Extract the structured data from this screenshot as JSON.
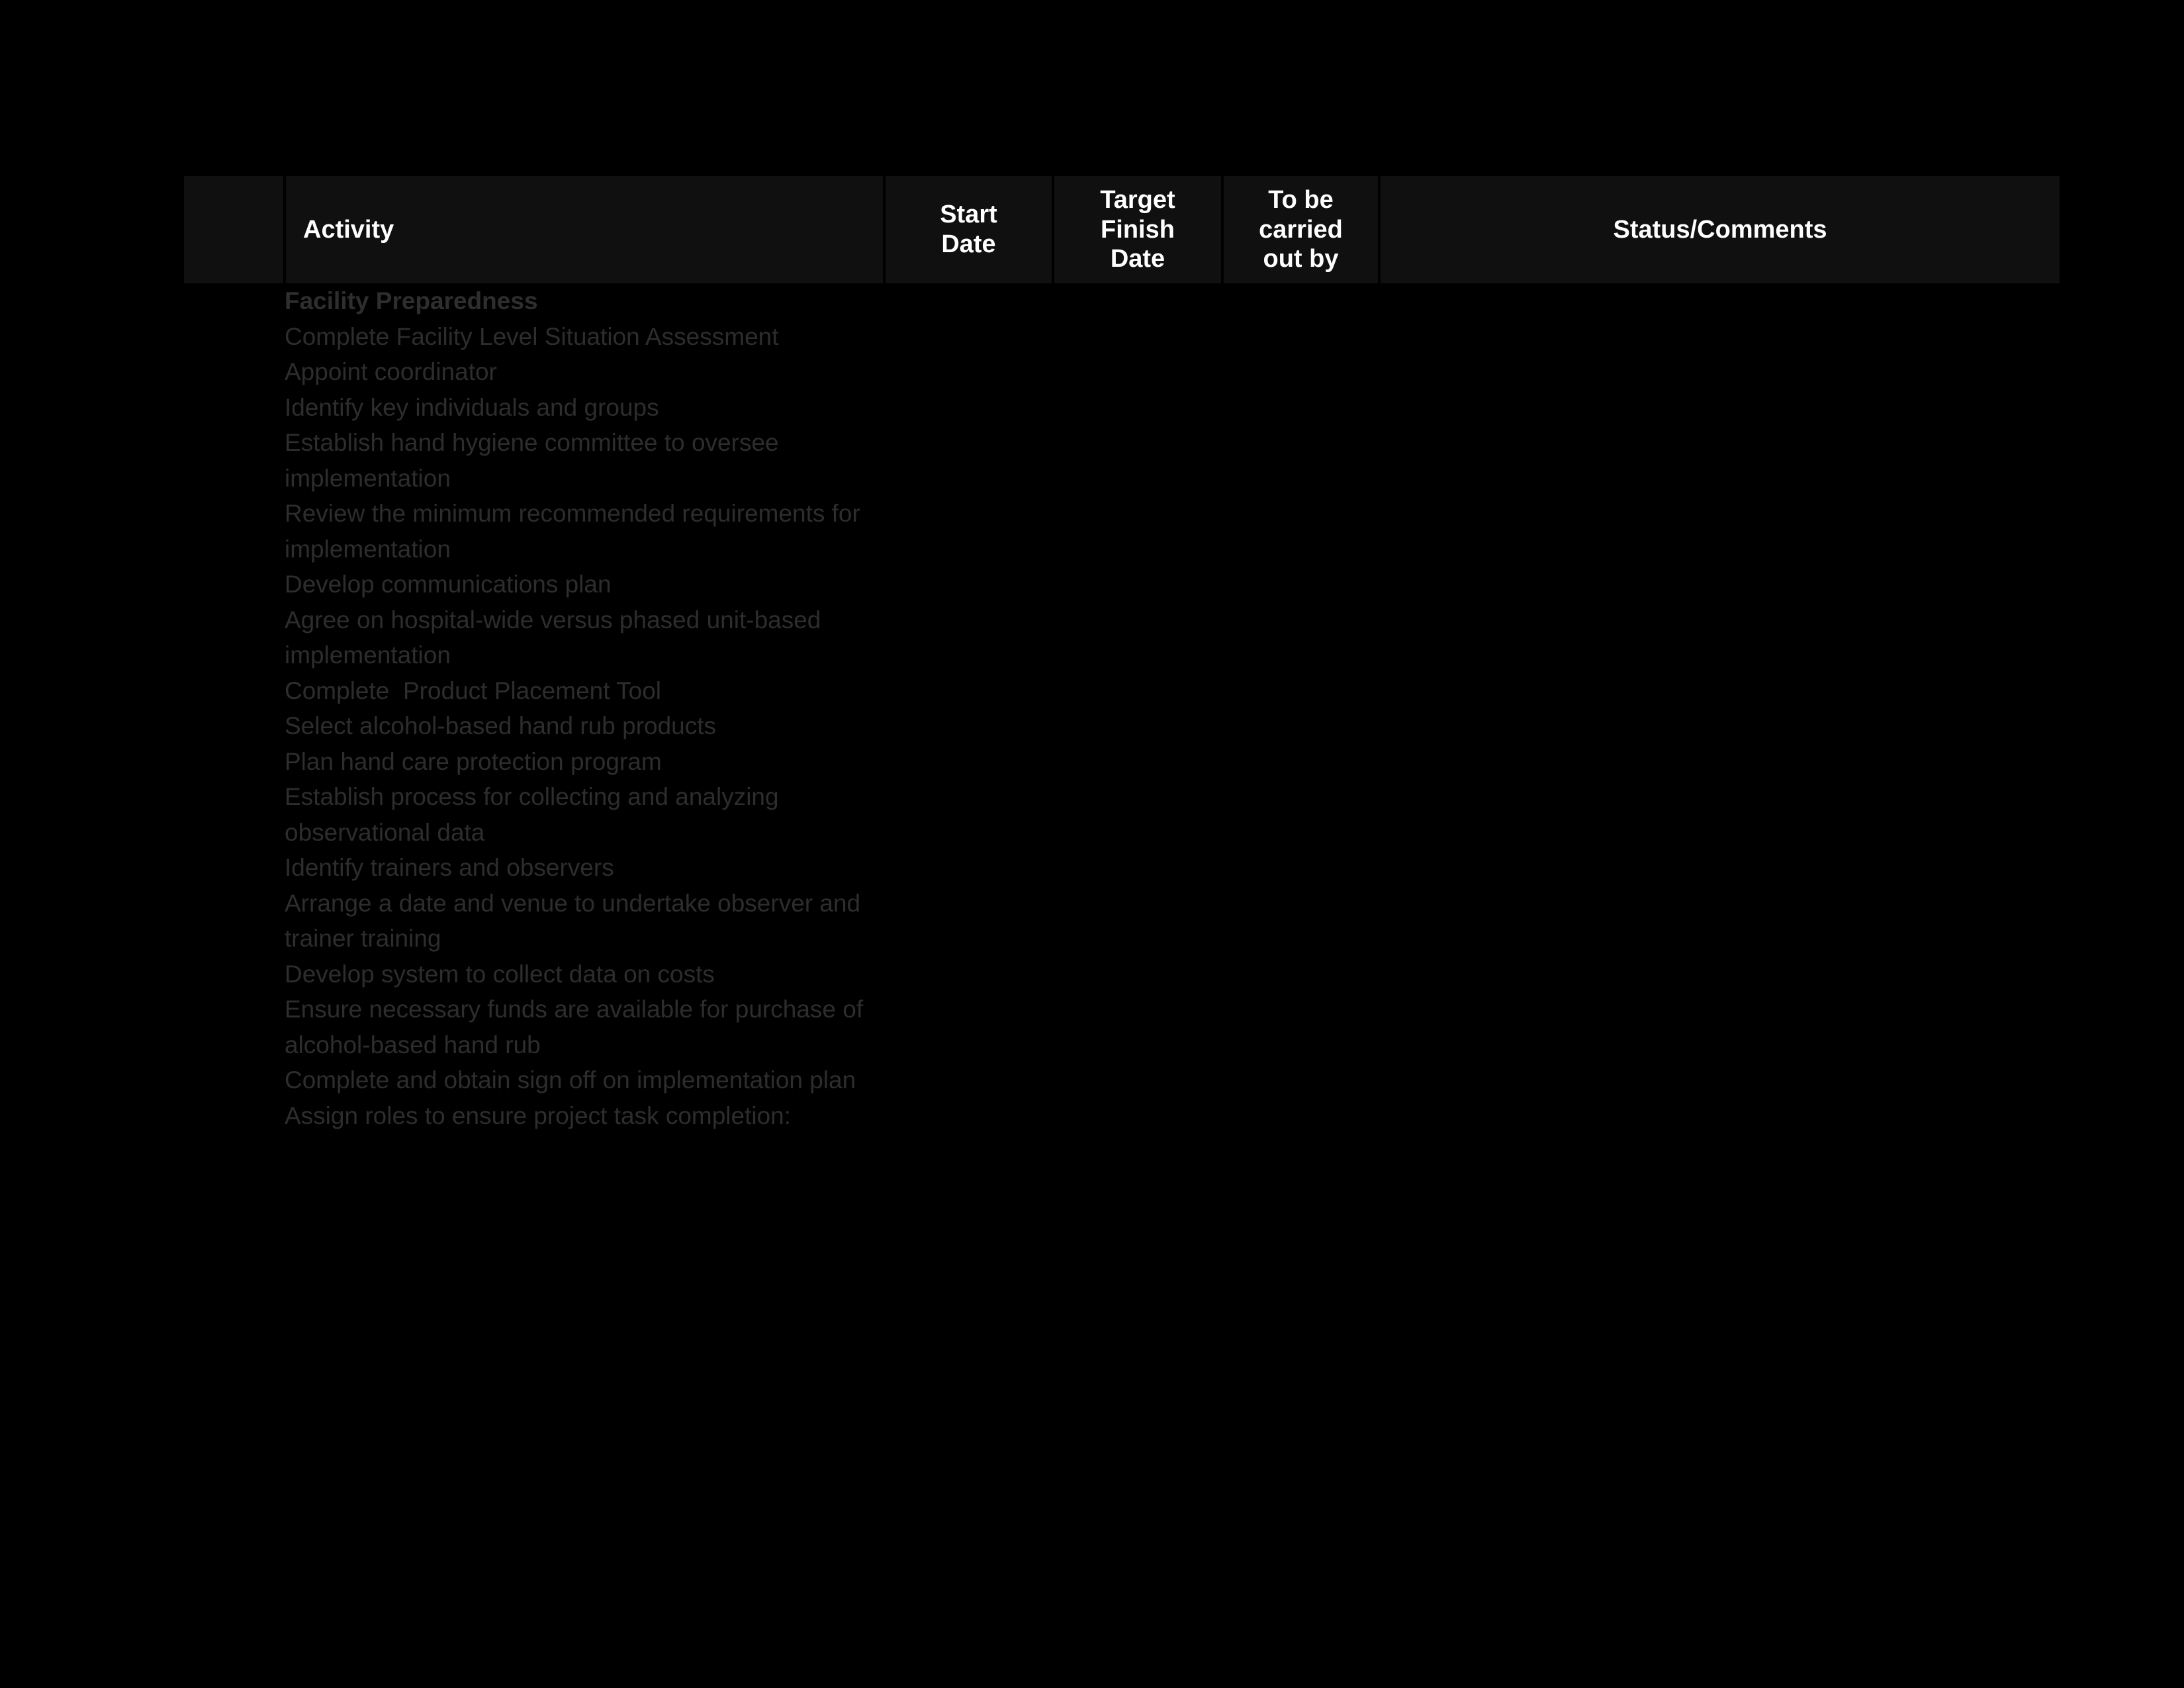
{
  "table": {
    "columns": [
      {
        "key": "marker",
        "label": "",
        "align": "center"
      },
      {
        "key": "activity",
        "label": "Activity",
        "align": "left"
      },
      {
        "key": "start",
        "label": "Start\nDate",
        "align": "center"
      },
      {
        "key": "target",
        "label": "Target\nFinish\nDate",
        "align": "center"
      },
      {
        "key": "owner",
        "label": "To be\ncarried\nout by",
        "align": "center"
      },
      {
        "key": "status",
        "label": "Status/Comments",
        "align": "center"
      }
    ],
    "header": {
      "marker": "",
      "activity": "Activity",
      "start_line1": "Start",
      "start_line2": "Date",
      "target_line1": "Target",
      "target_line2": "Finish",
      "target_line3": "Date",
      "owner_line1": "To be",
      "owner_line2": "carried",
      "owner_line3": "out by",
      "status": "Status/Comments"
    },
    "rows": [
      {
        "activity": "Facility Preparedness",
        "is_heading": true,
        "start": "",
        "target": "",
        "owner": "",
        "status": ""
      },
      {
        "activity": "Complete Facility Level Situation Assessment",
        "is_heading": false,
        "start": "",
        "target": "",
        "owner": "",
        "status": ""
      },
      {
        "activity": "Appoint coordinator",
        "is_heading": false,
        "start": "",
        "target": "",
        "owner": "",
        "status": ""
      },
      {
        "activity": "Identify key individuals and groups",
        "is_heading": false,
        "start": "",
        "target": "",
        "owner": "",
        "status": ""
      },
      {
        "activity": "Establish hand hygiene committee to oversee implementation",
        "is_heading": false,
        "start": "",
        "target": "",
        "owner": "",
        "status": ""
      },
      {
        "activity": "Review the minimum recommended requirements for implementation",
        "is_heading": false,
        "start": "",
        "target": "",
        "owner": "",
        "status": ""
      },
      {
        "activity": "Develop communications plan",
        "is_heading": false,
        "start": "",
        "target": "",
        "owner": "",
        "status": ""
      },
      {
        "activity": "Agree on hospital-wide versus phased unit-based implementation",
        "is_heading": false,
        "start": "",
        "target": "",
        "owner": "",
        "status": ""
      },
      {
        "activity": "Complete  Product Placement Tool",
        "is_heading": false,
        "start": "",
        "target": "",
        "owner": "",
        "status": ""
      },
      {
        "activity": "Select alcohol-based hand rub products",
        "is_heading": false,
        "start": "",
        "target": "",
        "owner": "",
        "status": ""
      },
      {
        "activity": "Plan hand care protection program",
        "is_heading": false,
        "start": "",
        "target": "",
        "owner": "",
        "status": ""
      },
      {
        "activity": "Establish process for collecting and analyzing observational data",
        "is_heading": false,
        "start": "",
        "target": "",
        "owner": "",
        "status": ""
      },
      {
        "activity": "Identify trainers and observers",
        "is_heading": false,
        "start": "",
        "target": "",
        "owner": "",
        "status": ""
      },
      {
        "activity": "Arrange a date and venue to undertake observer and trainer training",
        "is_heading": false,
        "start": "",
        "target": "",
        "owner": "",
        "status": ""
      },
      {
        "activity": "Develop system to collect data on costs",
        "is_heading": false,
        "start": "",
        "target": "",
        "owner": "",
        "status": ""
      },
      {
        "activity": "Ensure necessary funds are available for purchase of alcohol-based hand rub",
        "is_heading": false,
        "start": "",
        "target": "",
        "owner": "",
        "status": ""
      },
      {
        "activity": "Complete and obtain sign off on implementation plan",
        "is_heading": false,
        "start": "",
        "target": "",
        "owner": "",
        "status": ""
      },
      {
        "activity": "Assign roles to ensure project task completion:",
        "is_heading": false,
        "start": "",
        "target": "",
        "owner": "",
        "status": ""
      }
    ]
  },
  "colors": {
    "page_background": "#000000",
    "header_background": "#101010",
    "header_text": "#ffffff",
    "body_text": "#2d2d2d",
    "cell_divider": "#000000"
  }
}
